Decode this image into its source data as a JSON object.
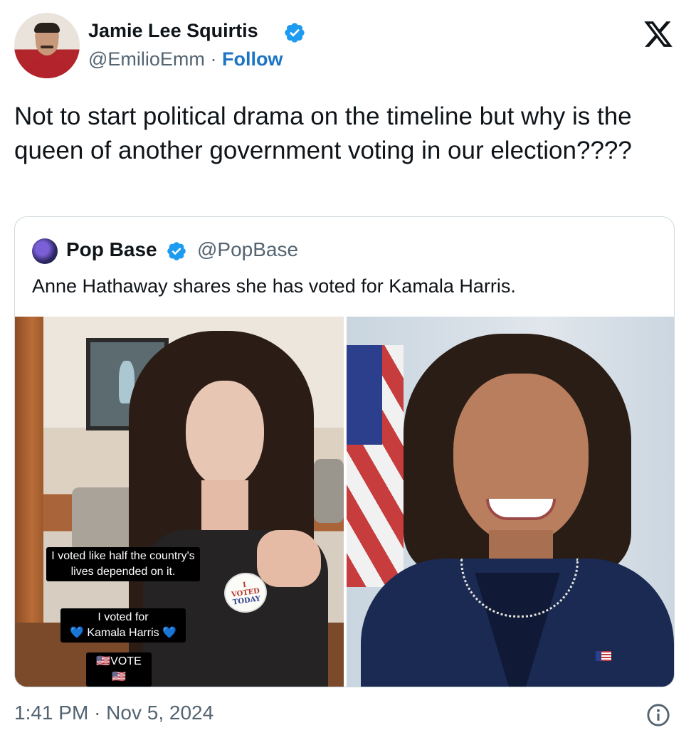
{
  "author": {
    "name": "Jamie Lee Squirtis",
    "handle": "@EmilioEmm",
    "separator": "·",
    "follow_label": "Follow",
    "verified_color": "#1d9bf0"
  },
  "brand": {
    "logo_icon": "x-logo-icon"
  },
  "tweet": {
    "text": "Not to start political drama on the timeline but why is the queen of another government voting in our election????"
  },
  "quote": {
    "name": "Pop Base",
    "handle": "@PopBase",
    "text": "Anne Hathaway shares she has voted for Kamala Harris.",
    "image_left": {
      "caption_1": "I voted like half the country's lives depended on it.",
      "caption_2_line1": "I voted for",
      "caption_2_line2": "💙 Kamala Harris 💙",
      "caption_3": "🇺🇸VOTE 🇺🇸",
      "sticker_text_1": "I",
      "sticker_text_2": "VOTED",
      "sticker_text_3": "TODAY"
    }
  },
  "timestamp": {
    "time": "1:41 PM",
    "separator": "·",
    "date": "Nov 5, 2024"
  },
  "colors": {
    "text": "#0f1419",
    "secondary": "#536471",
    "link": "#1d74c4",
    "border": "#cfd9de"
  }
}
